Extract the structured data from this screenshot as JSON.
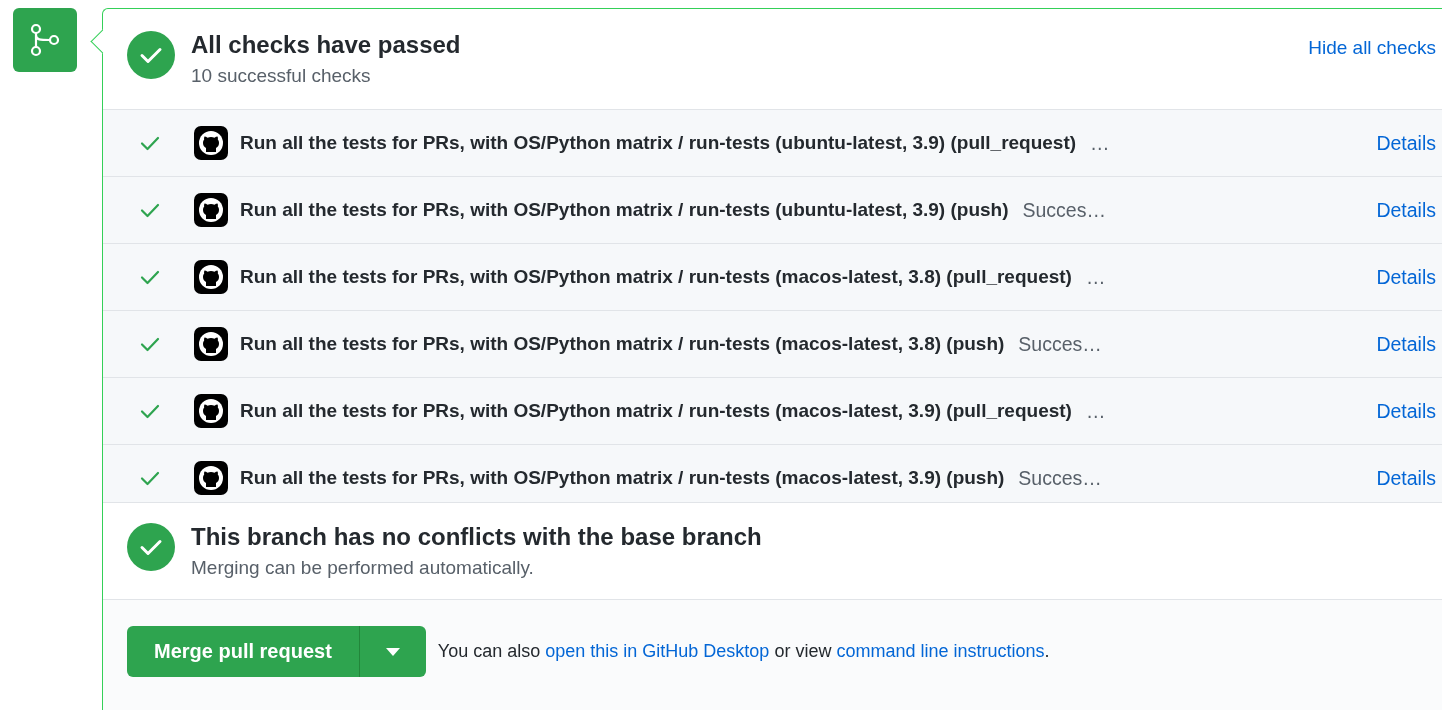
{
  "summary": {
    "title": "All checks have passed",
    "subtitle": "10 successful checks",
    "toggle": "Hide all checks"
  },
  "checks": [
    {
      "name": "Run all the tests for PRs, with OS/Python matrix / run-tests (ubuntu-latest, 3.9) (pull_request)",
      "status": "…",
      "link": "Details"
    },
    {
      "name": "Run all the tests for PRs, with OS/Python matrix / run-tests (ubuntu-latest, 3.9) (push)",
      "status": "Succes…",
      "link": "Details"
    },
    {
      "name": "Run all the tests for PRs, with OS/Python matrix / run-tests (macos-latest, 3.8) (pull_request)",
      "status": "…",
      "link": "Details"
    },
    {
      "name": "Run all the tests for PRs, with OS/Python matrix / run-tests (macos-latest, 3.8) (push)",
      "status": "Succes…",
      "link": "Details"
    },
    {
      "name": "Run all the tests for PRs, with OS/Python matrix / run-tests (macos-latest, 3.9) (pull_request)",
      "status": "…",
      "link": "Details"
    },
    {
      "name": "Run all the tests for PRs, with OS/Python matrix / run-tests (macos-latest, 3.9) (push)",
      "status": "Succes…",
      "link": "Details"
    }
  ],
  "merge_status": {
    "title": "This branch has no conflicts with the base branch",
    "subtitle": "Merging can be performed automatically."
  },
  "merge": {
    "button": "Merge pull request",
    "text_before": "You can also",
    "link_1": "open this in GitHub Desktop",
    "text_middle": "or view",
    "link_2": "command line instructions",
    "text_after": "."
  }
}
